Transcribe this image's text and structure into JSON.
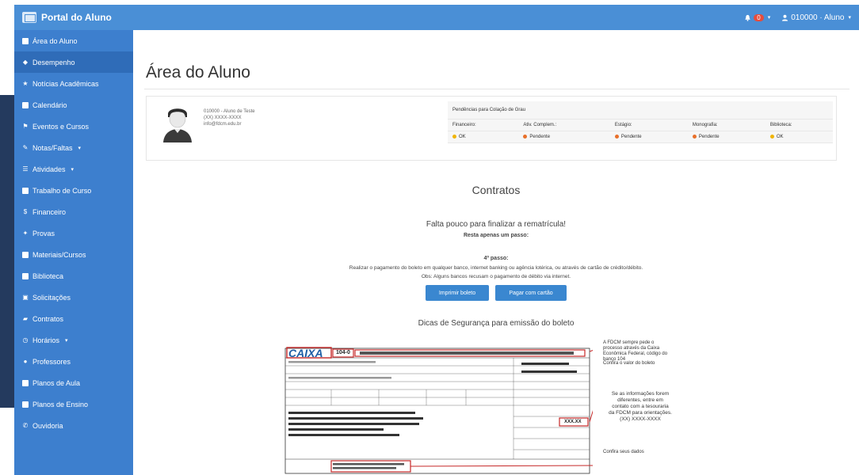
{
  "app": {
    "brand": "Portal do Aluno"
  },
  "topbar": {
    "notification_count": "0",
    "user": "010000 · Aluno"
  },
  "sidebar": {
    "items": [
      {
        "label": "Área do Aluno",
        "icon": "home-icon"
      },
      {
        "label": "Desempenho",
        "icon": "dashboard-icon"
      },
      {
        "label": "Notícias Acadêmicas",
        "icon": "star-icon"
      },
      {
        "label": "Calendário",
        "icon": "calendar-icon"
      },
      {
        "label": "Eventos e Cursos",
        "icon": "flag-icon"
      },
      {
        "label": "Notas/Faltas",
        "icon": "pencil-icon",
        "dropdown": true
      },
      {
        "label": "Atividades",
        "icon": "list-icon",
        "dropdown": true
      },
      {
        "label": "Trabalho de Curso",
        "icon": "book-icon"
      },
      {
        "label": "Financeiro",
        "icon": "dollar-icon"
      },
      {
        "label": "Provas",
        "icon": "test-icon"
      },
      {
        "label": "Materiais/Cursos",
        "icon": "folder-icon"
      },
      {
        "label": "Biblioteca",
        "icon": "library-icon"
      },
      {
        "label": "Solicitações",
        "icon": "request-icon"
      },
      {
        "label": "Contratos",
        "icon": "contract-icon"
      },
      {
        "label": "Horários",
        "icon": "clock-icon",
        "dropdown": true
      },
      {
        "label": "Professores",
        "icon": "user-icon"
      },
      {
        "label": "Planos de Aula",
        "icon": "plan-icon"
      },
      {
        "label": "Planos de Ensino",
        "icon": "plan-icon"
      },
      {
        "label": "Ouvidoria",
        "icon": "phone-icon"
      }
    ]
  },
  "main": {
    "title": "Área do Aluno",
    "profile": {
      "line1": "010000 - Aluno de Teste",
      "line2": "(XX) XXXX-XXXX",
      "line3": "info@fdcm.edu.br"
    },
    "pendencias": {
      "title": "Pendências para Colação de Grau",
      "columns": [
        "Financeiro:",
        "Ativ. Complem.:",
        "Estágio:",
        "Monografia:",
        "Biblioteca:"
      ],
      "values": [
        "OK",
        "Pendente",
        "Pendente",
        "Pendente",
        "OK"
      ]
    },
    "contratos": {
      "heading": "Contratos",
      "falta": "Falta pouco para finalizar a rematrícula!",
      "resta": "Resta apenas um passo:",
      "passo": "4º passo:",
      "realizar": "Realizar o pagamento do boleto em qualquer banco, internet banking ou agência lotérica, ou através de cartão de crédito/débito.",
      "obs": "Obs: Alguns bancos recusam o pagamento de débito via internet.",
      "btn_imprimir": "Imprimir boleto",
      "btn_pagar": "Pagar com cartão"
    },
    "dicas": {
      "heading": "Dicas de Segurança para emissão do boleto",
      "bank": "CAIXA",
      "bank_code": "104-0",
      "value_box": "XXX.XX",
      "note1": "A FDCM sempre pede o processo através da Caixa Econômica Federal, código do banco 104",
      "note2": "Confira o valor do boleto",
      "note3": "Se as informações forem diferentes, entre em contato com a tesouraria da FDCM para orientações.",
      "note3_phone": "(XX) XXXX-XXXX",
      "note4": "Confira seus dados"
    }
  }
}
